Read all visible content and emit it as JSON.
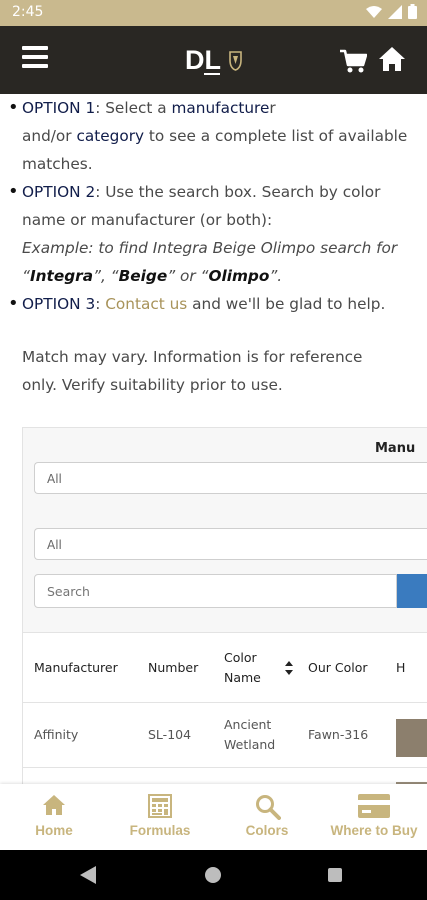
{
  "status": {
    "time": "2:45"
  },
  "header": {
    "logo_text": "DL"
  },
  "content": {
    "option1": {
      "label": "OPTION 1",
      "t1": ": Select a ",
      "b1": "manufacture",
      "t2": "r",
      "t3": "and/or ",
      "b2": "category",
      "t4": " to see a complete list of available matches."
    },
    "option2": {
      "label": "OPTION 2",
      "t1": ": Use the search box. Search by color name or manufacturer (or both):",
      "ex1": "Example: to find Integra Beige Olimpo search for “",
      "ex_t1": "Integra",
      "ex2": "”, “",
      "ex_t2": "Beige",
      "ex3": "” or “",
      "ex_t3": "Olimpo",
      "ex4": "”."
    },
    "option3": {
      "label": "OPTION 3",
      "t1": ": ",
      "link": "Contact us",
      "t2": " and we'll be glad to help."
    },
    "disclaimer": "Match may vary. Information is for reference only. Verify suitability prior to use."
  },
  "filter": {
    "manufacturer_label": "Manu",
    "manufacturer_select": "All",
    "category_select": "All",
    "search_placeholder": "Search"
  },
  "table": {
    "headers": [
      "Manufacturer",
      "Number",
      "Color Name",
      "Our Color",
      "H"
    ],
    "rows": [
      {
        "manufacturer": "Affinity",
        "number": "SL-104",
        "color_name": "Ancient Wetland",
        "our_color": "Fawn-316",
        "swatch": "#8c7f6d"
      }
    ]
  },
  "tabs": [
    {
      "label": "Home",
      "icon": "home-icon"
    },
    {
      "label": "Formulas",
      "icon": "calculator-icon"
    },
    {
      "label": "Colors",
      "icon": "search-icon"
    },
    {
      "label": "Where to Buy",
      "icon": "credit-card-icon"
    }
  ],
  "colors": {
    "header_bg": "#292723",
    "status_bg": "#c9b98e",
    "accent": "#c8b57e",
    "link": "#a8935a",
    "search_button": "#3a7bbf"
  }
}
